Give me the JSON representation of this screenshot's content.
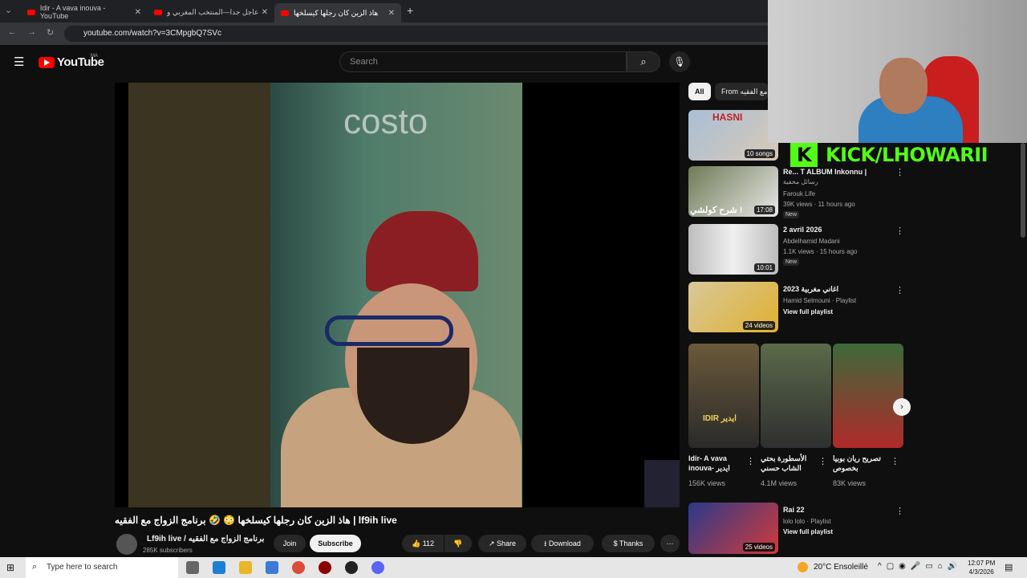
{
  "browser": {
    "tabs": [
      {
        "label": "Idir - A vava inouva - YouTube"
      },
      {
        "label": "عاجل جدا—المنتخب المغربي و"
      },
      {
        "label": "هاذ الزين كان رجلها كيسلخها"
      }
    ],
    "url": "youtube.com/watch?v=3CMpgbQ7SVc"
  },
  "youtube": {
    "logo": "YouTube",
    "region": "MA",
    "search_placeholder": "Search"
  },
  "video": {
    "watermark": "costo",
    "title": "lf9ih live | هاذ الزين كان رجلها كيسلخها 😳 🤣 برنامج الزواج مع الفقيه",
    "channel": "Lf9ih live / برنامج الزواج مع الفقيه",
    "subscribers": "285K subscribers",
    "join": "Join",
    "subscribe": "Subscribe",
    "likes": "112",
    "share": "Share",
    "download": "Download",
    "thanks": "Thanks"
  },
  "sidebar": {
    "chips": [
      "All",
      "From برنامج الزواج مع الفقيه"
    ],
    "items": [
      {
        "title": "",
        "meta1": "",
        "meta2": "",
        "badge": "10 songs",
        "thumb_text": "HASNI"
      },
      {
        "title": "Re... T ALBUM Inkonnu |",
        "meta1": "رسائل مخفية",
        "channel": "Farouk Life",
        "meta2": "39K views · 11 hours ago",
        "new": "New",
        "badge": "17:08",
        "thumb_text": "شرح كولشي !"
      },
      {
        "title": "2 avril 2026",
        "channel": "Abdelhamid Madani",
        "meta2": "1.1K views · 15 hours ago",
        "new": "New",
        "badge": "10:01"
      },
      {
        "title": "اغاني مغربية 2023",
        "channel": "Hamid Selmouni · Playlist",
        "meta2": "View full playlist",
        "badge": "24 videos"
      },
      {
        "title": "Rai 22",
        "channel": "lolo lolo · Playlist",
        "meta2": "View full playlist",
        "badge": "25 videos"
      }
    ],
    "shelf": [
      {
        "title": "Idir- A vava inouva- ايدير",
        "views": "156K views",
        "thumb_text": "IDIR ايدير"
      },
      {
        "title": "الأسطورة بحتي الشاب حسني",
        "views": "4.1M views"
      },
      {
        "title": "تصريح ريان بوبيا بخصوص",
        "views": "83K views"
      }
    ]
  },
  "overlay": {
    "kick_text": "KICK/LHOWARII",
    "kick_logo": "K"
  },
  "taskbar": {
    "search": "Type here to search",
    "weather": "20°C  Ensoleillé",
    "time": "12:07 PM",
    "date": "4/3/2026"
  }
}
